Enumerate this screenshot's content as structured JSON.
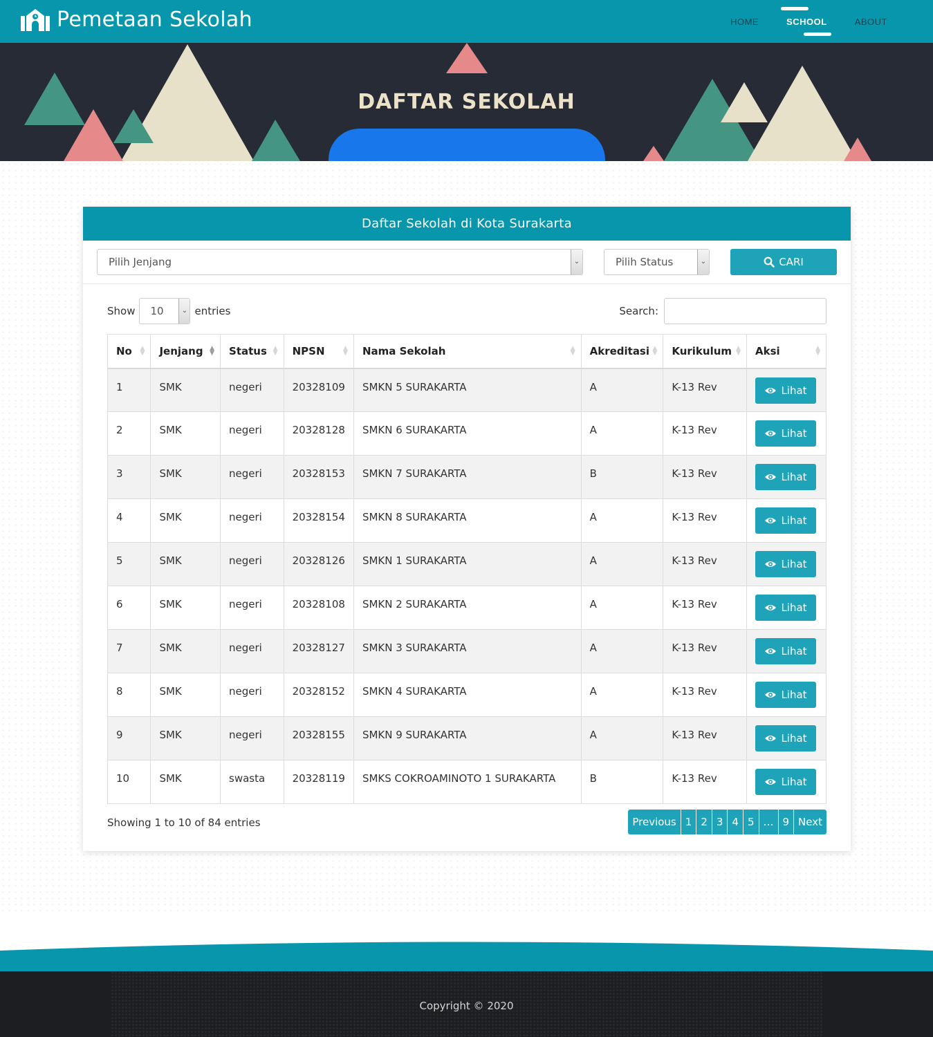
{
  "brand": {
    "name": "Pemetaan Sekolah",
    "icon": "school-building-icon"
  },
  "nav": {
    "items": [
      "HOME",
      "SCHOOL",
      "ABOUT"
    ],
    "active": "SCHOOL"
  },
  "hero": {
    "title": "DAFTAR SEKOLAH"
  },
  "card": {
    "title": "Daftar Sekolah di Kota Surakarta",
    "jenjang_select": "Pilih Jenjang",
    "status_select": "Pilih Status",
    "search_button": "CARI",
    "search_icon": "search-icon"
  },
  "datatable": {
    "show_label": "Show",
    "length_value": "10",
    "entries_label": "entries",
    "search_label": "Search:",
    "search_value": "",
    "columns": [
      "No",
      "Jenjang",
      "Status",
      "NPSN",
      "Nama Sekolah",
      "Akreditasi",
      "Kurikulum",
      "Aksi"
    ],
    "action_label": "Lihat",
    "action_icon": "eye-icon",
    "rows": [
      [
        "1",
        "SMK",
        "negeri",
        "20328109",
        "SMKN 5 SURAKARTA",
        "A",
        "K-13 Rev"
      ],
      [
        "2",
        "SMK",
        "negeri",
        "20328128",
        "SMKN 6 SURAKARTA",
        "A",
        "K-13 Rev"
      ],
      [
        "3",
        "SMK",
        "negeri",
        "20328153",
        "SMKN 7 SURAKARTA",
        "B",
        "K-13 Rev"
      ],
      [
        "4",
        "SMK",
        "negeri",
        "20328154",
        "SMKN 8 SURAKARTA",
        "A",
        "K-13 Rev"
      ],
      [
        "5",
        "SMK",
        "negeri",
        "20328126",
        "SMKN 1 SURAKARTA",
        "A",
        "K-13 Rev"
      ],
      [
        "6",
        "SMK",
        "negeri",
        "20328108",
        "SMKN 2 SURAKARTA",
        "A",
        "K-13 Rev"
      ],
      [
        "7",
        "SMK",
        "negeri",
        "20328127",
        "SMKN 3 SURAKARTA",
        "A",
        "K-13 Rev"
      ],
      [
        "8",
        "SMK",
        "negeri",
        "20328152",
        "SMKN 4 SURAKARTA",
        "A",
        "K-13 Rev"
      ],
      [
        "9",
        "SMK",
        "negeri",
        "20328155",
        "SMKN 9 SURAKARTA",
        "A",
        "K-13 Rev"
      ],
      [
        "10",
        "SMK",
        "swasta",
        "20328119",
        "SMKS COKROAMINOTO 1 SURAKARTA",
        "B",
        "K-13 Rev"
      ]
    ],
    "info": "Showing 1 to 10 of 84 entries",
    "pagination": [
      "Previous",
      "1",
      "2",
      "3",
      "4",
      "5",
      "…",
      "9",
      "Next"
    ]
  },
  "footer": {
    "copyright": "Copyright © 2020"
  },
  "colors": {
    "primary": "#0896ad",
    "button": "#1fa3b8",
    "hero_bg": "#262b36",
    "hero_title": "#ece2c7",
    "pill": "#1877ea",
    "triangle_cream": "#e8e1c9",
    "triangle_green": "#449682",
    "triangle_pink": "#e5898a",
    "footer_bg": "#1d1e21"
  }
}
